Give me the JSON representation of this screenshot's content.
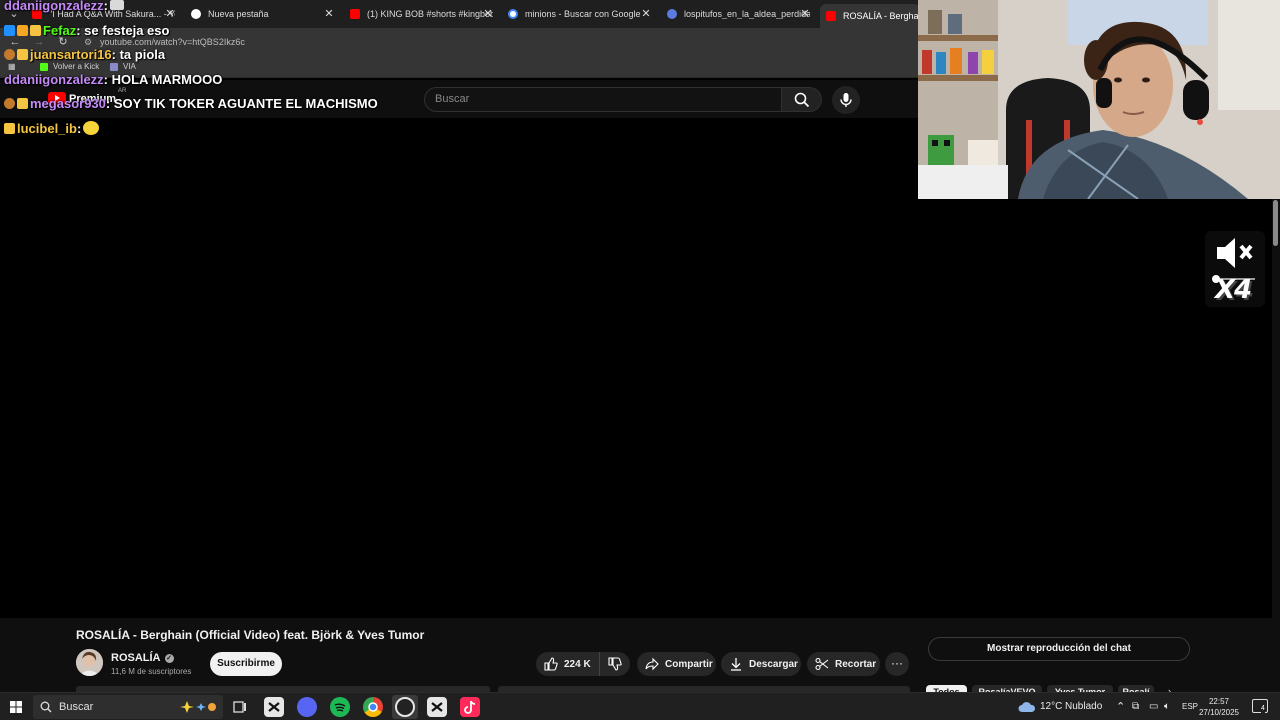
{
  "browser": {
    "tabs": [
      {
        "title": "\"I Had A Q&A With Sakura... - Yo",
        "favicon": "youtube"
      },
      {
        "title": "Nueva pestaña",
        "favicon": "chrome"
      },
      {
        "title": "(1) KING BOB #shorts #kingbob",
        "favicon": "youtube"
      },
      {
        "title": "minions - Buscar con Google",
        "favicon": "google"
      },
      {
        "title": "lospitufos_en_la_aldea_perdida",
        "favicon": "site"
      },
      {
        "title": "ROSALÍA - Berghain (O",
        "favicon": "youtube",
        "active": true
      }
    ],
    "url": "youtube.com/watch?v=htQBS2Ikz6c",
    "bookmarks": [
      {
        "label": "Volver a Kick",
        "color": "#53fc18"
      },
      {
        "label": "VIA",
        "color": "#c0392b"
      }
    ]
  },
  "youtube": {
    "logo_text": "Premium",
    "country_code": "AR",
    "search_placeholder": "Buscar"
  },
  "chat": [
    {
      "user": "ddaniigonzalezz",
      "text": " :",
      "color": "#c58af9",
      "emote": true
    },
    {
      "user": "Fefaz",
      "text": " : se festeja eso",
      "color": "#53fc18"
    },
    {
      "user": "juansartori16",
      "text": " : ta piola",
      "color": "#f5c542"
    },
    {
      "user": "ddaniigonzalezz",
      "text": " : HOLA MARMOOO",
      "color": "#c58af9"
    },
    {
      "user": "megasor930",
      "text": " : SOY TIK TOKER AGUANTE EL MACHISMO",
      "color": "#c58af9"
    },
    {
      "user": "lucibel_ib",
      "text": " :",
      "color": "#f5c542",
      "emote": true
    }
  ],
  "overlay": {
    "multiplier": "X4"
  },
  "video": {
    "title": "ROSALÍA - Berghain (Official Video) feat. Björk & Yves Tumor",
    "channel": "ROSALÍA",
    "subscribers": "11,6 M de suscriptores",
    "subscribe_label": "Suscribirme",
    "likes": "224 K",
    "share_label": "Compartir",
    "download_label": "Descargar",
    "clip_label": "Recortar",
    "more_label": "···"
  },
  "sidebar": {
    "chat_replay_label": "Mostrar reproducción del chat",
    "chips": [
      "Todos",
      "RosalíaVEVO",
      "Yves Tumor",
      "Rosalí"
    ]
  },
  "taskbar": {
    "search_label": "Buscar",
    "weather": "12°C",
    "weather_desc": "Nublado",
    "language": "ESP",
    "time": "22:57",
    "date": "27/10/2025",
    "notification_count": "4"
  }
}
